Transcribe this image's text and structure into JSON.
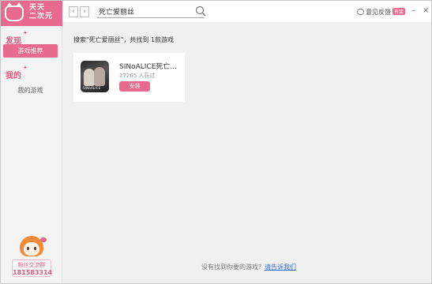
{
  "app": {
    "logo_line1": "天天",
    "logo_line2": "二次元"
  },
  "sidebar": {
    "section_discover": "发现",
    "item_recommended": "游戏推荐",
    "section_mine": "我的",
    "item_my_games": "我的游戏",
    "group_name": "粉丝交流群",
    "group_number": "181583314"
  },
  "topbar": {
    "search_value": "死亡爱丽丝",
    "feedback_label": "意见反馈",
    "feedback_badge": "有奖"
  },
  "main": {
    "result_prefix": "搜索\"",
    "result_keyword": "死亡爱丽丝",
    "result_suffix": "\"，共找到 ",
    "result_count": "1",
    "result_unit": "款游戏",
    "games": [
      {
        "title": "SINoALICE死亡...",
        "players": "27265 人玩过",
        "install_label": "安装",
        "thumb_tag": "SINoALICE"
      }
    ],
    "footer_text": "没有找到你要的游戏？",
    "footer_link": "请告诉我们"
  },
  "colors": {
    "accent": "#e96a8f",
    "link": "#3a6fd8"
  },
  "icons": [
    "back-arrow-icon",
    "forward-arrow-icon",
    "search-icon",
    "chat-icon",
    "minimize-icon",
    "close-icon",
    "cat-logo-icon"
  ]
}
